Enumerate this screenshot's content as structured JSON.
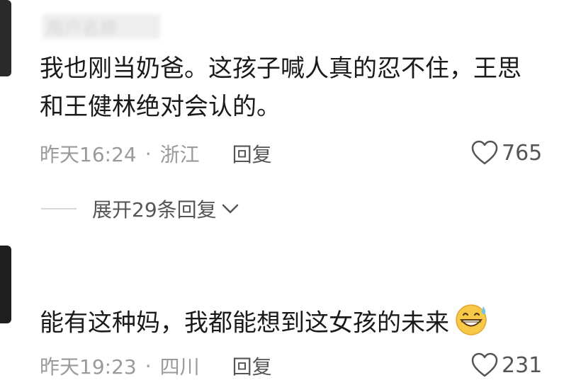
{
  "comments": [
    {
      "username": "",
      "text_line1": "我也刚当奶爸。这孩子喊人真的忍不住，王思",
      "text_line2": "和王健林绝对会认的。",
      "time": "昨天16:24",
      "separator": "·",
      "location": "浙江",
      "reply_label": "回复",
      "likes": "765",
      "expand_label": "展开29条回复"
    },
    {
      "text_line1": "能有这种妈，我都能想到这女孩的未来",
      "emoji": "grinning-sweat-emoji",
      "time": "昨天19:23",
      "separator": "·",
      "location": "四川",
      "reply_label": "回复",
      "likes": "231"
    }
  ],
  "icons": {
    "like": "heart-outline-icon",
    "expand": "chevron-down-icon"
  },
  "colors": {
    "text": "#1a1a1a",
    "meta": "#9a9a9a",
    "accent_emoji": "#f7c948"
  }
}
